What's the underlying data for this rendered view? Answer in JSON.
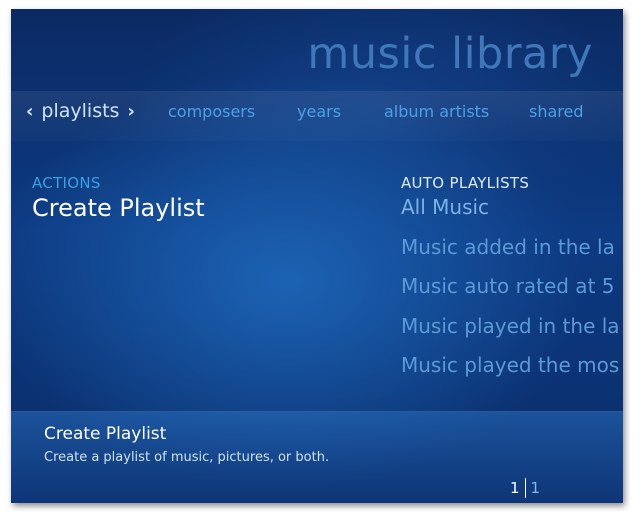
{
  "header": {
    "title": "music library"
  },
  "nav": {
    "active": "playlists",
    "items": [
      "composers",
      "years",
      "album artists",
      "shared"
    ]
  },
  "actions": {
    "label": "ACTIONS",
    "create_playlist": "Create Playlist"
  },
  "auto_playlists": {
    "label": "AUTO PLAYLISTS",
    "items": [
      "All Music",
      "Music added in the la",
      "Music auto rated at 5",
      "Music played in the la",
      "Music played the mos"
    ]
  },
  "description": {
    "title": "Create Playlist",
    "text": "Create a playlist of music, pictures, or both."
  },
  "pager": {
    "current": "1",
    "total": "1"
  },
  "colors": {
    "background": "#0d3a82",
    "accent": "#37a2e2",
    "text": "#ffffff"
  }
}
